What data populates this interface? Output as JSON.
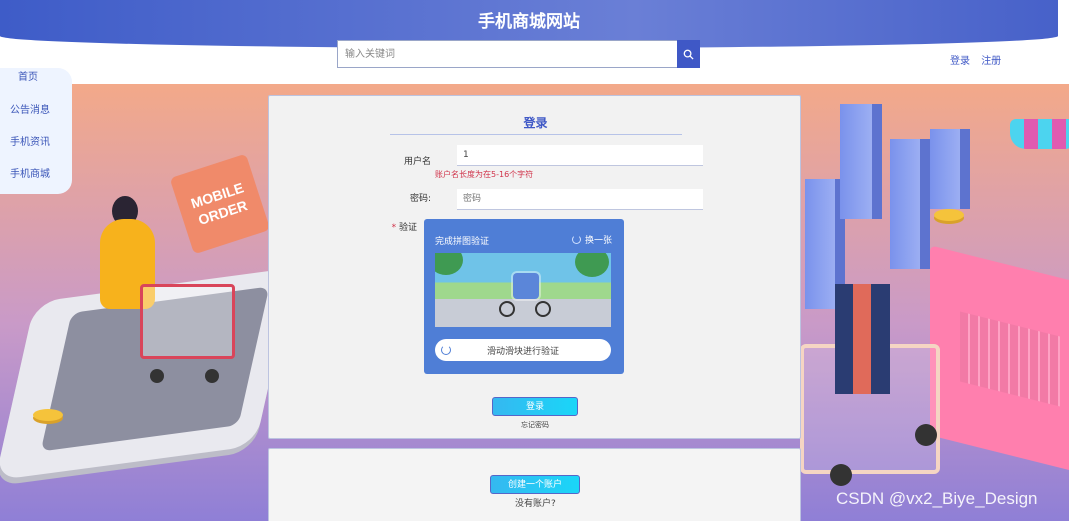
{
  "header": {
    "site_title": "手机商城网站",
    "search_placeholder": "输入关键词",
    "login_link": "登录",
    "register_link": "注册"
  },
  "sidebar": {
    "items": [
      {
        "label": "首页"
      },
      {
        "label": "公告消息"
      },
      {
        "label": "手机资讯"
      },
      {
        "label": "手机商城"
      }
    ]
  },
  "login": {
    "title": "登录",
    "username_label": "用户名",
    "username_value": "1",
    "username_error": "账户名长度为在5-16个字符",
    "password_label": "密码:",
    "password_placeholder": "密码",
    "captcha_label": "验证",
    "required_mark": "*",
    "captcha_title": "完成拼图验证",
    "captcha_refresh": "换一张",
    "slider_text": "滑动滑块进行验证",
    "login_button": "登录",
    "forgot_password": "忘记密码"
  },
  "register": {
    "create_button": "创建一个账户",
    "no_account": "没有账户?"
  },
  "illustration": {
    "sign_line1": "MOBILE",
    "sign_line2": "ORDER"
  },
  "watermark": "CSDN @vx2_Biye_Design",
  "colors": {
    "primary": "#3f58c6",
    "error": "#d0334a",
    "captcha_bg": "#4f7ed6",
    "button": "#35b8f0"
  }
}
